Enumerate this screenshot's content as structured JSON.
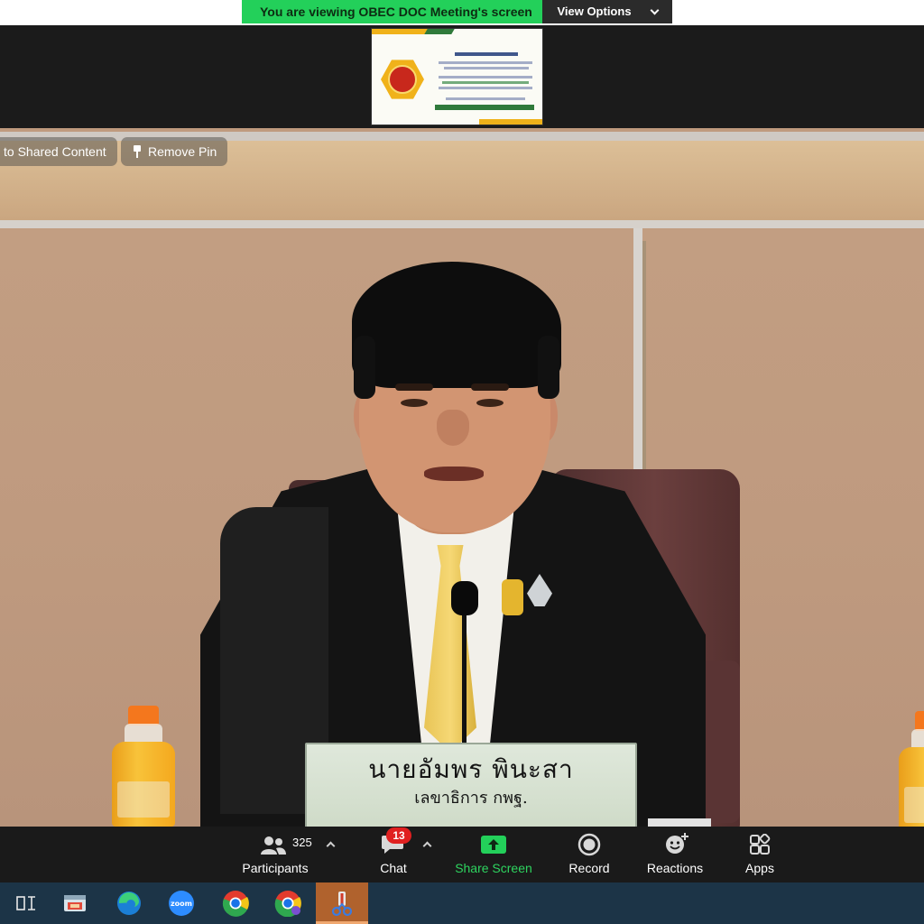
{
  "banner": {
    "viewing_text": "You are viewing OBEC DOC Meeting's screen",
    "options_label": "View Options"
  },
  "video": {
    "switch_pill": "to Shared Content",
    "remove_pin": "Remove Pin",
    "nameplate_name": "นายอัมพร  พินะสา",
    "nameplate_title": "เลขาธิการ กพฐ."
  },
  "toolbar": {
    "participants_label": "Participants",
    "participants_count": "325",
    "chat_label": "Chat",
    "chat_badge": "13",
    "share_label": "Share Screen",
    "record_label": "Record",
    "reactions_label": "Reactions",
    "apps_label": "Apps"
  },
  "taskbar": {
    "apps": [
      "task-view-icon",
      "file-explorer-icon",
      "edge-icon",
      "zoom-icon",
      "chrome-icon",
      "chrome-profile-icon",
      "snipping-tool-icon"
    ]
  },
  "colors": {
    "banner_green": "#23d05a",
    "share_green": "#2ed45f",
    "badge_red": "#e02020",
    "taskbar_bg": "#1c3447",
    "active_task": "#b0622d"
  }
}
